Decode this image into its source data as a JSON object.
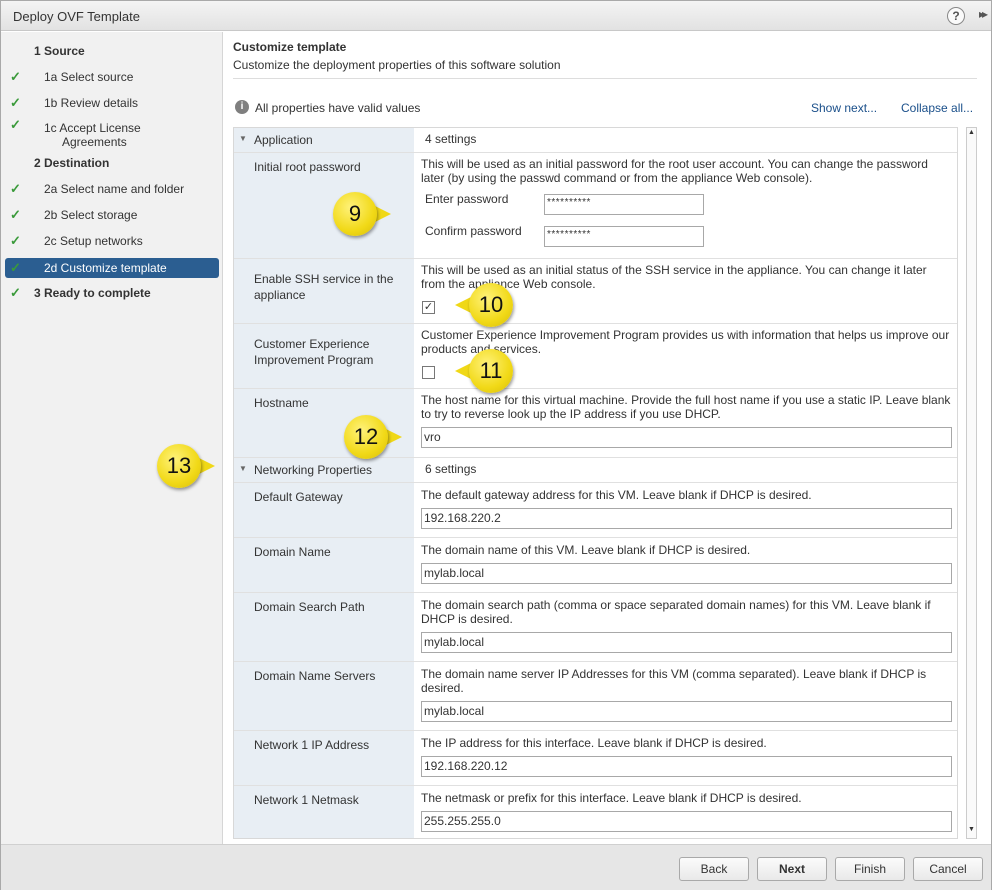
{
  "window": {
    "title": "Deploy OVF Template"
  },
  "sidebar": {
    "steps": [
      {
        "label": "1  Source",
        "checked": false,
        "type": "head"
      },
      {
        "label": "1a  Select source",
        "checked": true,
        "type": "sub"
      },
      {
        "label": "1b  Review details",
        "checked": true,
        "type": "sub"
      },
      {
        "label": "1c  Accept License",
        "label2": "Agreements",
        "checked": true,
        "type": "sub"
      },
      {
        "label": "2  Destination",
        "checked": false,
        "type": "head"
      },
      {
        "label": "2a  Select name and folder",
        "checked": true,
        "type": "sub"
      },
      {
        "label": "2b  Select storage",
        "checked": true,
        "type": "sub"
      },
      {
        "label": "2c  Setup networks",
        "checked": true,
        "type": "sub"
      },
      {
        "label": "2d  Customize template",
        "checked": true,
        "type": "sub",
        "active": true
      },
      {
        "label": "3  Ready to complete",
        "checked": true,
        "type": "head"
      }
    ]
  },
  "main": {
    "title": "Customize template",
    "subtitle": "Customize the deployment properties of this software solution",
    "info": "All properties have valid values",
    "show_next": "Show next...",
    "collapse_all": "Collapse all..."
  },
  "groups": {
    "application": {
      "label": "Application",
      "count": "4 settings"
    },
    "networking": {
      "label": "Networking Properties",
      "count": "6 settings"
    }
  },
  "props": {
    "root_password": {
      "label": "Initial root password",
      "desc": "This will be used as an initial password for the root user account. You can change the password later (by using the passwd command or from the appliance Web console).",
      "enter_label": "Enter password",
      "confirm_label": "Confirm password",
      "enter_value": "**********",
      "confirm_value": "**********"
    },
    "ssh": {
      "label": "Enable SSH service in the appliance",
      "desc": "This will be used as an initial status of the SSH service in the appliance. You can change it later from the appliance Web console.",
      "checked": true
    },
    "ceip": {
      "label": "Customer Experience Improvement Program",
      "desc": "Customer Experience Improvement Program provides us with information that helps us improve our products and services.",
      "checked": false
    },
    "hostname": {
      "label": "Hostname",
      "desc": "The host name for this virtual machine. Provide the full host name if you use a static IP. Leave blank to try to reverse look up the IP address if you use DHCP.",
      "value": "vro"
    },
    "gateway": {
      "label": "Default Gateway",
      "desc": "The default gateway address for this VM. Leave blank if DHCP is desired.",
      "value": "192.168.220.2"
    },
    "domain_name": {
      "label": "Domain Name",
      "desc": "The domain name of this VM. Leave blank if DHCP is desired.",
      "value": "mylab.local"
    },
    "search_path": {
      "label": "Domain Search Path",
      "desc": "The domain search path (comma or space separated domain names) for this VM. Leave blank if DHCP is desired.",
      "value": "mylab.local"
    },
    "dns": {
      "label": "Domain Name Servers",
      "desc": "The domain name server IP Addresses for this VM (comma separated). Leave blank if DHCP is desired.",
      "value": "mylab.local"
    },
    "ip": {
      "label": "Network 1 IP Address",
      "desc": "The IP address for this interface. Leave blank if DHCP is desired.",
      "value": "192.168.220.12"
    },
    "netmask": {
      "label": "Network 1 Netmask",
      "desc": "The netmask or prefix for this interface. Leave blank if DHCP is desired.",
      "value": "255.255.255.0"
    }
  },
  "callouts": {
    "c9": "9",
    "c10": "10",
    "c11": "11",
    "c12": "12",
    "c13": "13"
  },
  "footer": {
    "back": "Back",
    "next": "Next",
    "finish": "Finish",
    "cancel": "Cancel"
  },
  "icons": {
    "help": "?",
    "expand": "▸▸",
    "check": "✓",
    "caret": "▼"
  },
  "colors": {
    "active_step": "#2b5e91",
    "callout": "#f1d917",
    "check": "#3a9a3a"
  }
}
